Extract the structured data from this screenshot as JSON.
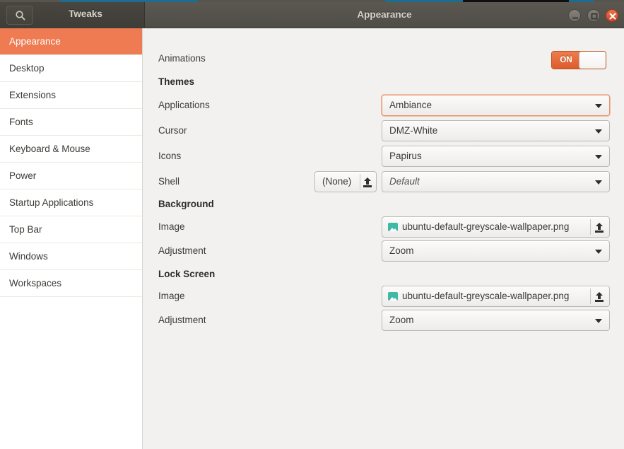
{
  "window": {
    "left_title": "Tweaks",
    "title": "Appearance",
    "search_icon": "search-icon",
    "buttons": {
      "minimize": "minimize-button",
      "maximize": "maximize-button",
      "close": "close-button"
    }
  },
  "sidebar": {
    "items": [
      {
        "label": "Appearance",
        "selected": true
      },
      {
        "label": "Desktop",
        "selected": false
      },
      {
        "label": "Extensions",
        "selected": false
      },
      {
        "label": "Fonts",
        "selected": false
      },
      {
        "label": "Keyboard & Mouse",
        "selected": false
      },
      {
        "label": "Power",
        "selected": false
      },
      {
        "label": "Startup Applications",
        "selected": false
      },
      {
        "label": "Top Bar",
        "selected": false
      },
      {
        "label": "Windows",
        "selected": false
      },
      {
        "label": "Workspaces",
        "selected": false
      }
    ]
  },
  "main": {
    "animations": {
      "label": "Animations",
      "state": "ON"
    },
    "themes": {
      "heading": "Themes",
      "applications": {
        "label": "Applications",
        "value": "Ambiance"
      },
      "cursor": {
        "label": "Cursor",
        "value": "DMZ-White"
      },
      "icons": {
        "label": "Icons",
        "value": "Papirus"
      },
      "shell": {
        "label": "Shell",
        "file_value": "(None)",
        "value": "Default"
      }
    },
    "background": {
      "heading": "Background",
      "image": {
        "label": "Image",
        "value": "ubuntu-default-greyscale-wallpaper.png"
      },
      "adjustment": {
        "label": "Adjustment",
        "value": "Zoom"
      }
    },
    "lock_screen": {
      "heading": "Lock Screen",
      "image": {
        "label": "Image",
        "value": "ubuntu-default-greyscale-wallpaper.png"
      },
      "adjustment": {
        "label": "Adjustment",
        "value": "Zoom"
      }
    }
  },
  "colors": {
    "accent": "#ef7b52",
    "titlebar": "#5b5852",
    "panel": "#f2f1f0",
    "sidebar": "#ffffff",
    "close_button": "#d0462a",
    "file_icon": "#3fb9a5"
  }
}
